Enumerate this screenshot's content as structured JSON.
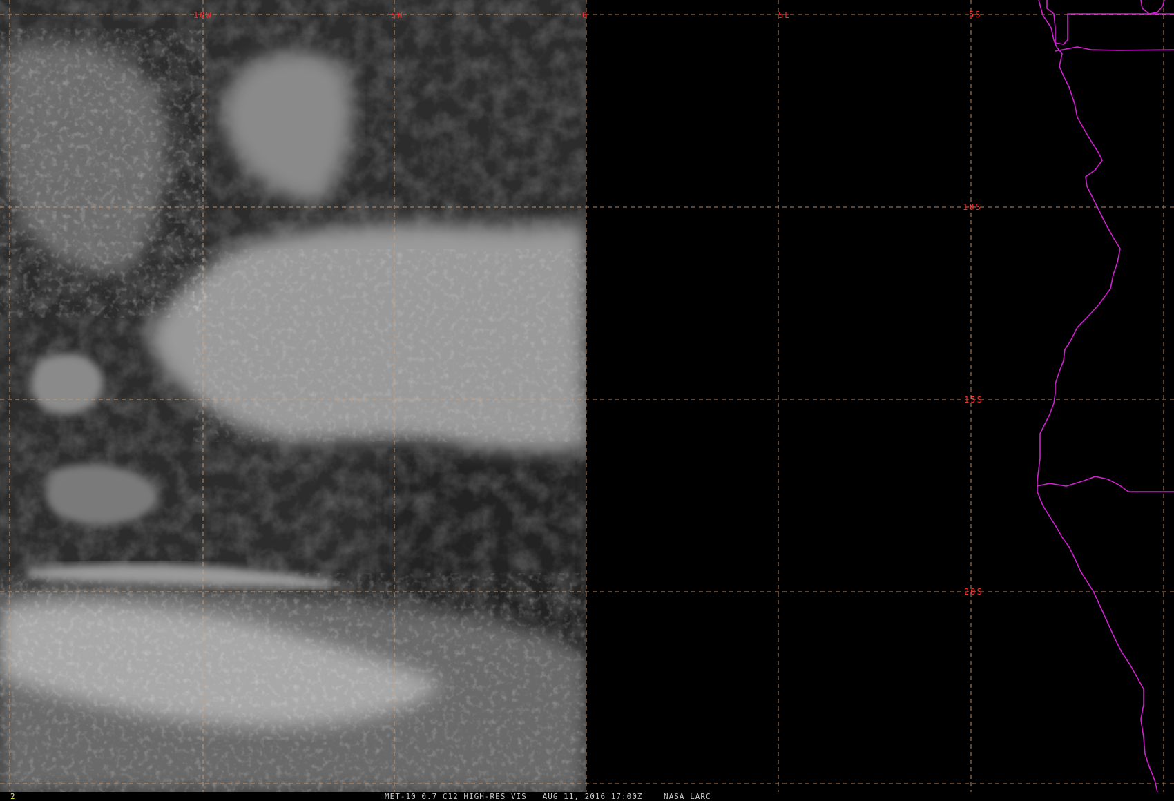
{
  "image": {
    "frame_number": "2",
    "caption": "MET-10 0.7 C12 HIGH-RES VIS   AUG 11, 2016 17:00Z    NASA LARC"
  },
  "grid": {
    "lon_labels": [
      "10W",
      "5W",
      "0",
      "5E"
    ],
    "lat_labels": [
      "5S",
      "10S",
      "15S",
      "20S"
    ],
    "line_color": "#d8a070",
    "label_color": "#ff2a2a"
  },
  "map": {
    "coastline_color": "#d020d0",
    "imagery_region": "western half",
    "background_color": "#000000"
  }
}
